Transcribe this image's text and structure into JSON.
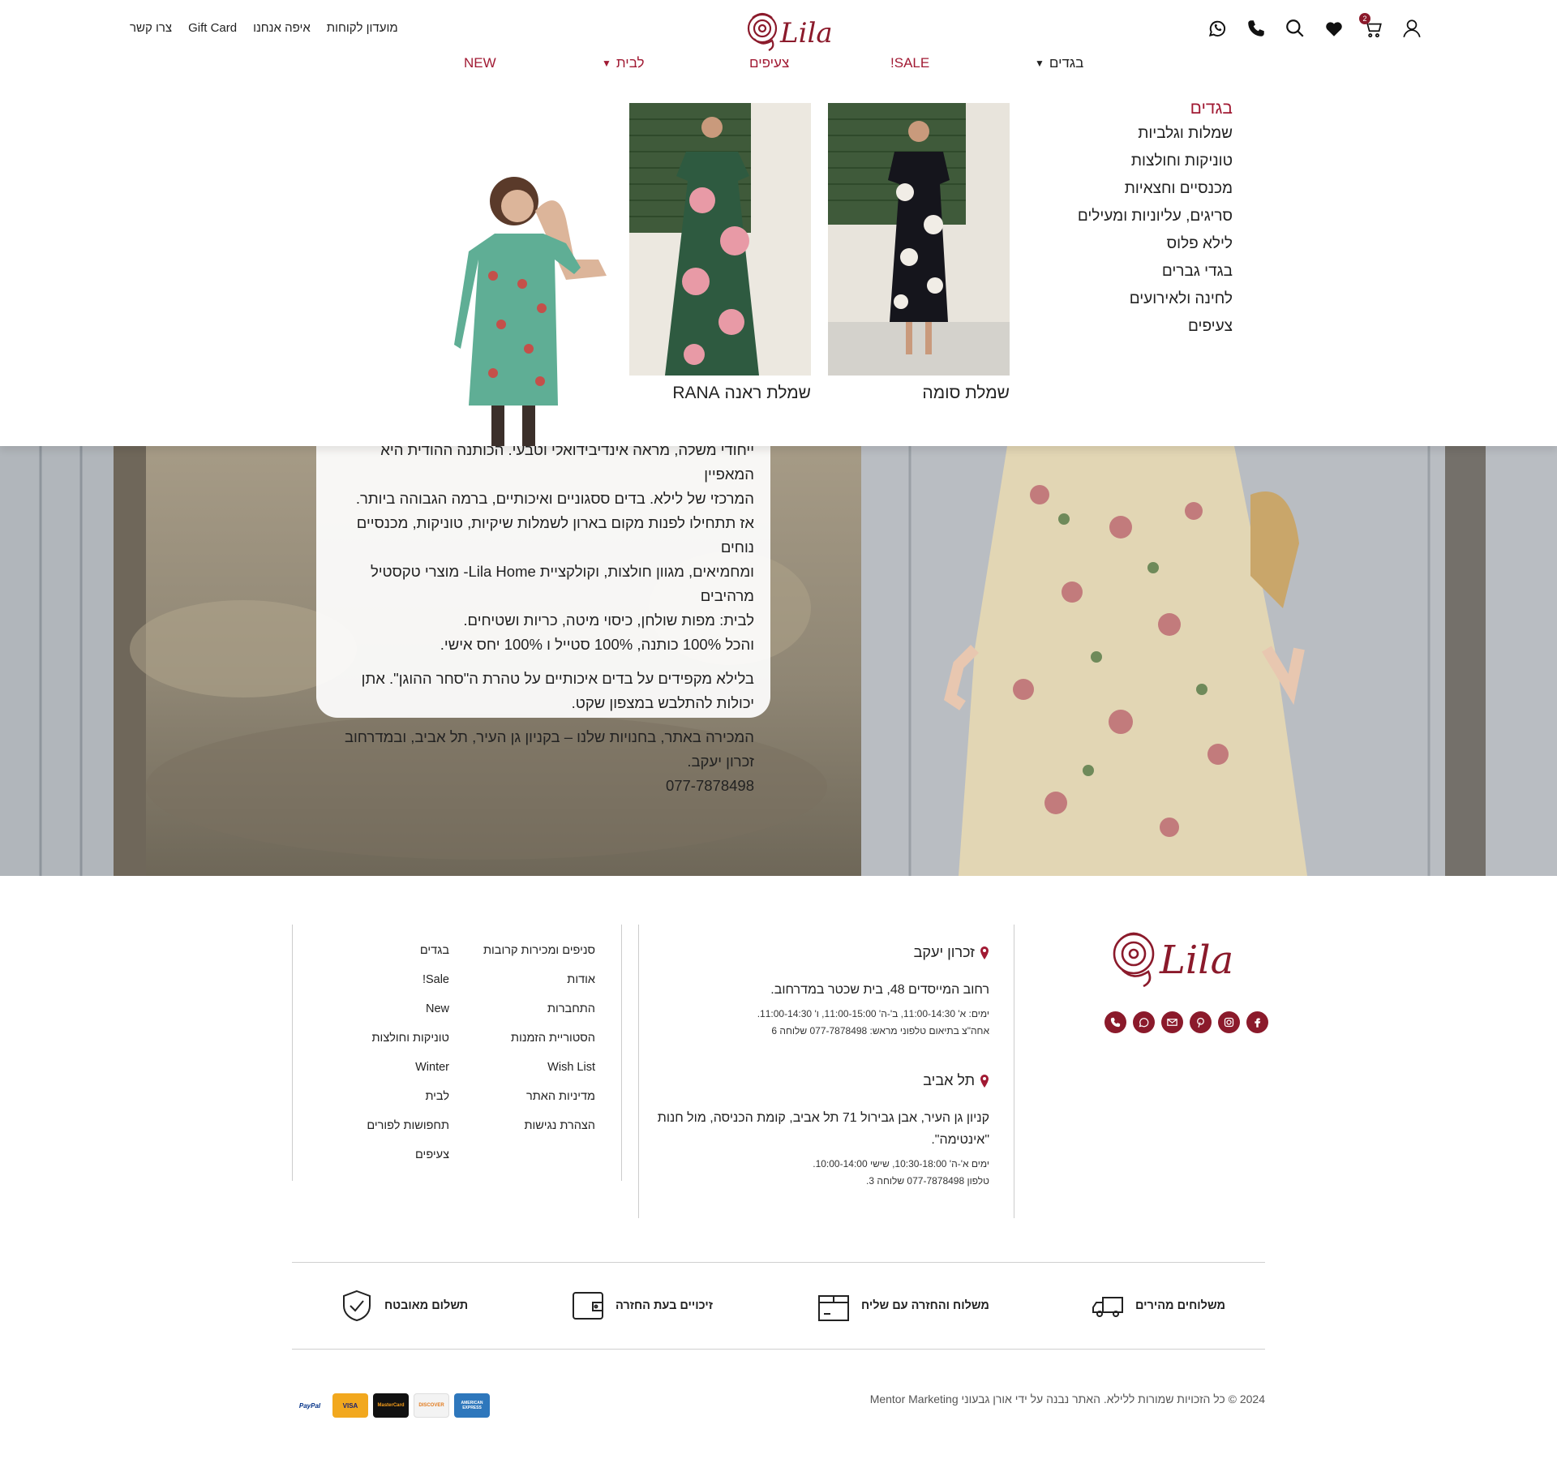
{
  "brand": {
    "name": "Lila",
    "accent": "#8b1a2b",
    "accent_text": "#a11a33"
  },
  "top_links": [
    "צרו קשר",
    "Gift Card",
    "איפה אנחנו",
    "מועדון לקוחות"
  ],
  "header_icons": {
    "cart_count": "2",
    "icons": [
      "user-icon",
      "cart-icon",
      "heart-icon",
      "search-icon",
      "phone-icon",
      "whatsapp-icon"
    ]
  },
  "nav": {
    "clothes": "בגדים",
    "sale": "SALE!",
    "scarves": "צעיפים",
    "home": "לבית",
    "new": "NEW"
  },
  "mega_menu": {
    "title": "בגדים",
    "categories": [
      "שמלות וגלביות",
      "טוניקות וחולצות",
      "מכנסיים וחצאיות",
      "סריגים, עליוניות ומעילים",
      "לילא פלוס",
      "בגדי גברים",
      "לחינה ולאירועים",
      "צעיפים"
    ],
    "products": [
      {
        "name": "שמלת סומה"
      },
      {
        "name": "שמלת ראנה RANA"
      }
    ]
  },
  "hero": {
    "lines1": [
      "ייחודי משלה, מראה אינדיבידואלי וטבעי. הכותנה ההודית היא המאפיין",
      "המרכזי של לילא. בדים ססגוניים ואיכותיים, ברמה הגבוהה ביותר.",
      "אז תתחילו לפנות מקום בארון לשמלות שיקיות, טוניקות, מכנסיים נוחים",
      "ומחמיאים, מגוון חולצות, וקולקציית Lila Home- מוצרי טקסטיל מרהיבים",
      "לבית: מפות שולחן, כיסוי מיטה, כריות ושטיחים.",
      "והכל 100% כותנה, 100% סטייל ו 100% יחס אישי."
    ],
    "para2": "בלילא מקפידים על בדים איכותיים על טהרת ה\"סחר ההוגן\". אתן יכולות להתלבש במצפון שקט.",
    "para3": "המכירה באתר, בחנויות שלנו – בקניון גן העיר, תל אביב, ובמדרחוב זכרון יעקב.",
    "phone": "077-7878498"
  },
  "branches": [
    {
      "title": "זכרון יעקב",
      "address": "רחוב המייסדים 48, בית שכטר במדרחוב.",
      "hours": "ימים: א' 11:00-14:30, ב'-ה' 11:00-15:00, ו' 11:00-14:30.",
      "note": "אחה\"צ בתיאום טלפוני מראש: 077-7878498 שלוחה 6"
    },
    {
      "title": "תל אביב",
      "address": "קניון גן העיר, אבן גבירול 71 תל אביב, קומת הכניסה, מול חנות \"אינטימה\".",
      "hours": "ימים א'-ה' 10:30-18:00, שישי 10:00-14:00.",
      "note": "טלפון 077-7878498 שלוחה 3."
    }
  ],
  "footer_links_a": [
    "סניפים ומכירות קרובות",
    "אודות",
    "התחברות",
    "הסטוריית הזמנות",
    "Wish List",
    "מדיניות האתר",
    "הצהרת נגישות"
  ],
  "footer_links_b": [
    "בגדים",
    "Sale!",
    "New",
    "טוניקות וחולצות",
    "Winter",
    "לבית",
    "תחפושות לפורים",
    "צעיפים"
  ],
  "features": [
    "משלוחים מהירים",
    "משלוח והחזרה עם שליח",
    "זיכויים בעת החזרה",
    "תשלום מאובטח"
  ],
  "copyright": "2024 © כל הזכויות שמורות ללילא. האתר נבנה על ידי אורן גבעוני Mentor Marketing",
  "payments": [
    "AMERICAN EXPRESS",
    "DISCOVER",
    "MasterCard",
    "VISA",
    "PayPal"
  ]
}
